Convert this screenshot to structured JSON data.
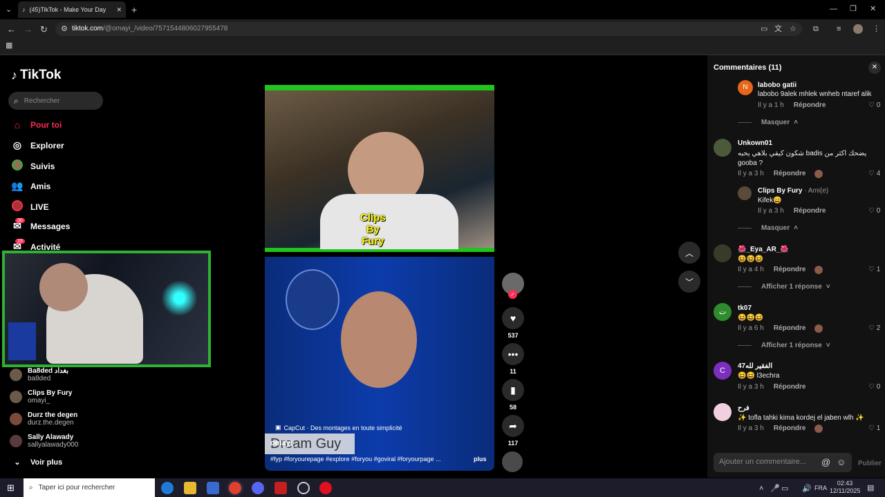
{
  "browser": {
    "tab_title": "(45)TikTok - Make Your Day",
    "url_host": "tiktok.com",
    "url_path": "/@omayi_/video/7571544806027955478"
  },
  "tiktok": {
    "logo": "TikTok",
    "search_placeholder": "Rechercher",
    "nav": [
      {
        "label": "Pour toi",
        "icon": "home-icon",
        "active": true
      },
      {
        "label": "Explorer",
        "icon": "compass-icon"
      },
      {
        "label": "Suivis",
        "icon": "following-avatar-icon"
      },
      {
        "label": "Amis",
        "icon": "friends-icon"
      },
      {
        "label": "LIVE",
        "icon": "live-icon"
      },
      {
        "label": "Messages",
        "icon": "messages-icon",
        "badge": "30"
      },
      {
        "label": "Activité",
        "icon": "activity-icon",
        "badge": "15"
      }
    ],
    "following": [
      {
        "name": "Ba8ded بغداد",
        "handle": "ba8ded"
      },
      {
        "name": "Clips By Fury",
        "handle": "omayi_"
      },
      {
        "name": "Durz the degen",
        "handle": "durz.the.degen"
      },
      {
        "name": "Sally Alawady",
        "handle": "sallyalawady000"
      }
    ],
    "see_more": "Voir plus"
  },
  "video": {
    "watermark1": "Clips",
    "watermark2": "By",
    "watermark3": "Fury",
    "capcut": "CapCut · Des montages en toute simplicité",
    "author": "omayi_",
    "caption": "#fyp #foryourepage #explore #foryou #goviral #foryourpage ...",
    "more": "plus",
    "banner_text": "Dream Guy"
  },
  "actions": {
    "likes": "537",
    "comments": "11",
    "saves": "58",
    "shares": "117"
  },
  "comments_panel": {
    "title": "Commentaires (11)",
    "reply_label": "Répondre",
    "hide_label": "Masquer",
    "show_reply_label": "Afficher 1 réponse",
    "input_placeholder": "Ajouter un commentaire...",
    "publish": "Publier",
    "comments": [
      {
        "name": "labobo gatii",
        "text": "labobo 9alek mhlek wnheb ntaref alik",
        "time": "Il y a 1 h",
        "likes": "0",
        "avatar_letter": "N",
        "avatar_color": "#e8651a"
      },
      {
        "name": "Unkown01",
        "text": "شكون كيفي بلاهي يحبه badis يضحك اكثر من gooba ?",
        "time": "Il y a 3 h",
        "likes": "4",
        "avatar_color": "#4a5a3a"
      },
      {
        "name": "Clips By Fury",
        "tag": "· Ami(e)",
        "text": "Kifek😄",
        "time": "Il y a 3 h",
        "likes": "0",
        "avatar_color": "#5a4a3a"
      },
      {
        "name": "🌺_Eya_AR_🌺",
        "text": "😆😆😆",
        "time": "Il y a 4 h",
        "likes": "1",
        "avatar_color": "#3a3a2a"
      },
      {
        "name": "tk07",
        "text": "😆😆😆",
        "time": "Il y a 6 h",
        "likes": "2",
        "avatar_letter": "ت",
        "avatar_color": "#2e8b2e"
      },
      {
        "name": "الفقير لله47",
        "text": "😆😆 l3echra",
        "time": "Il y a 3 h",
        "likes": "0",
        "avatar_letter": "C",
        "avatar_color": "#7b2fbf"
      },
      {
        "name": "فرح",
        "text": "✨ tofla tahki kima kordej el jaben wlh ✨",
        "time": "Il y a 3 h",
        "likes": "1",
        "avatar_color": "#f0d0e0"
      }
    ]
  },
  "taskbar": {
    "search_placeholder": "Taper ici pour rechercher",
    "time": "02:43",
    "date": "12/11/2025",
    "lang": "FRA"
  }
}
